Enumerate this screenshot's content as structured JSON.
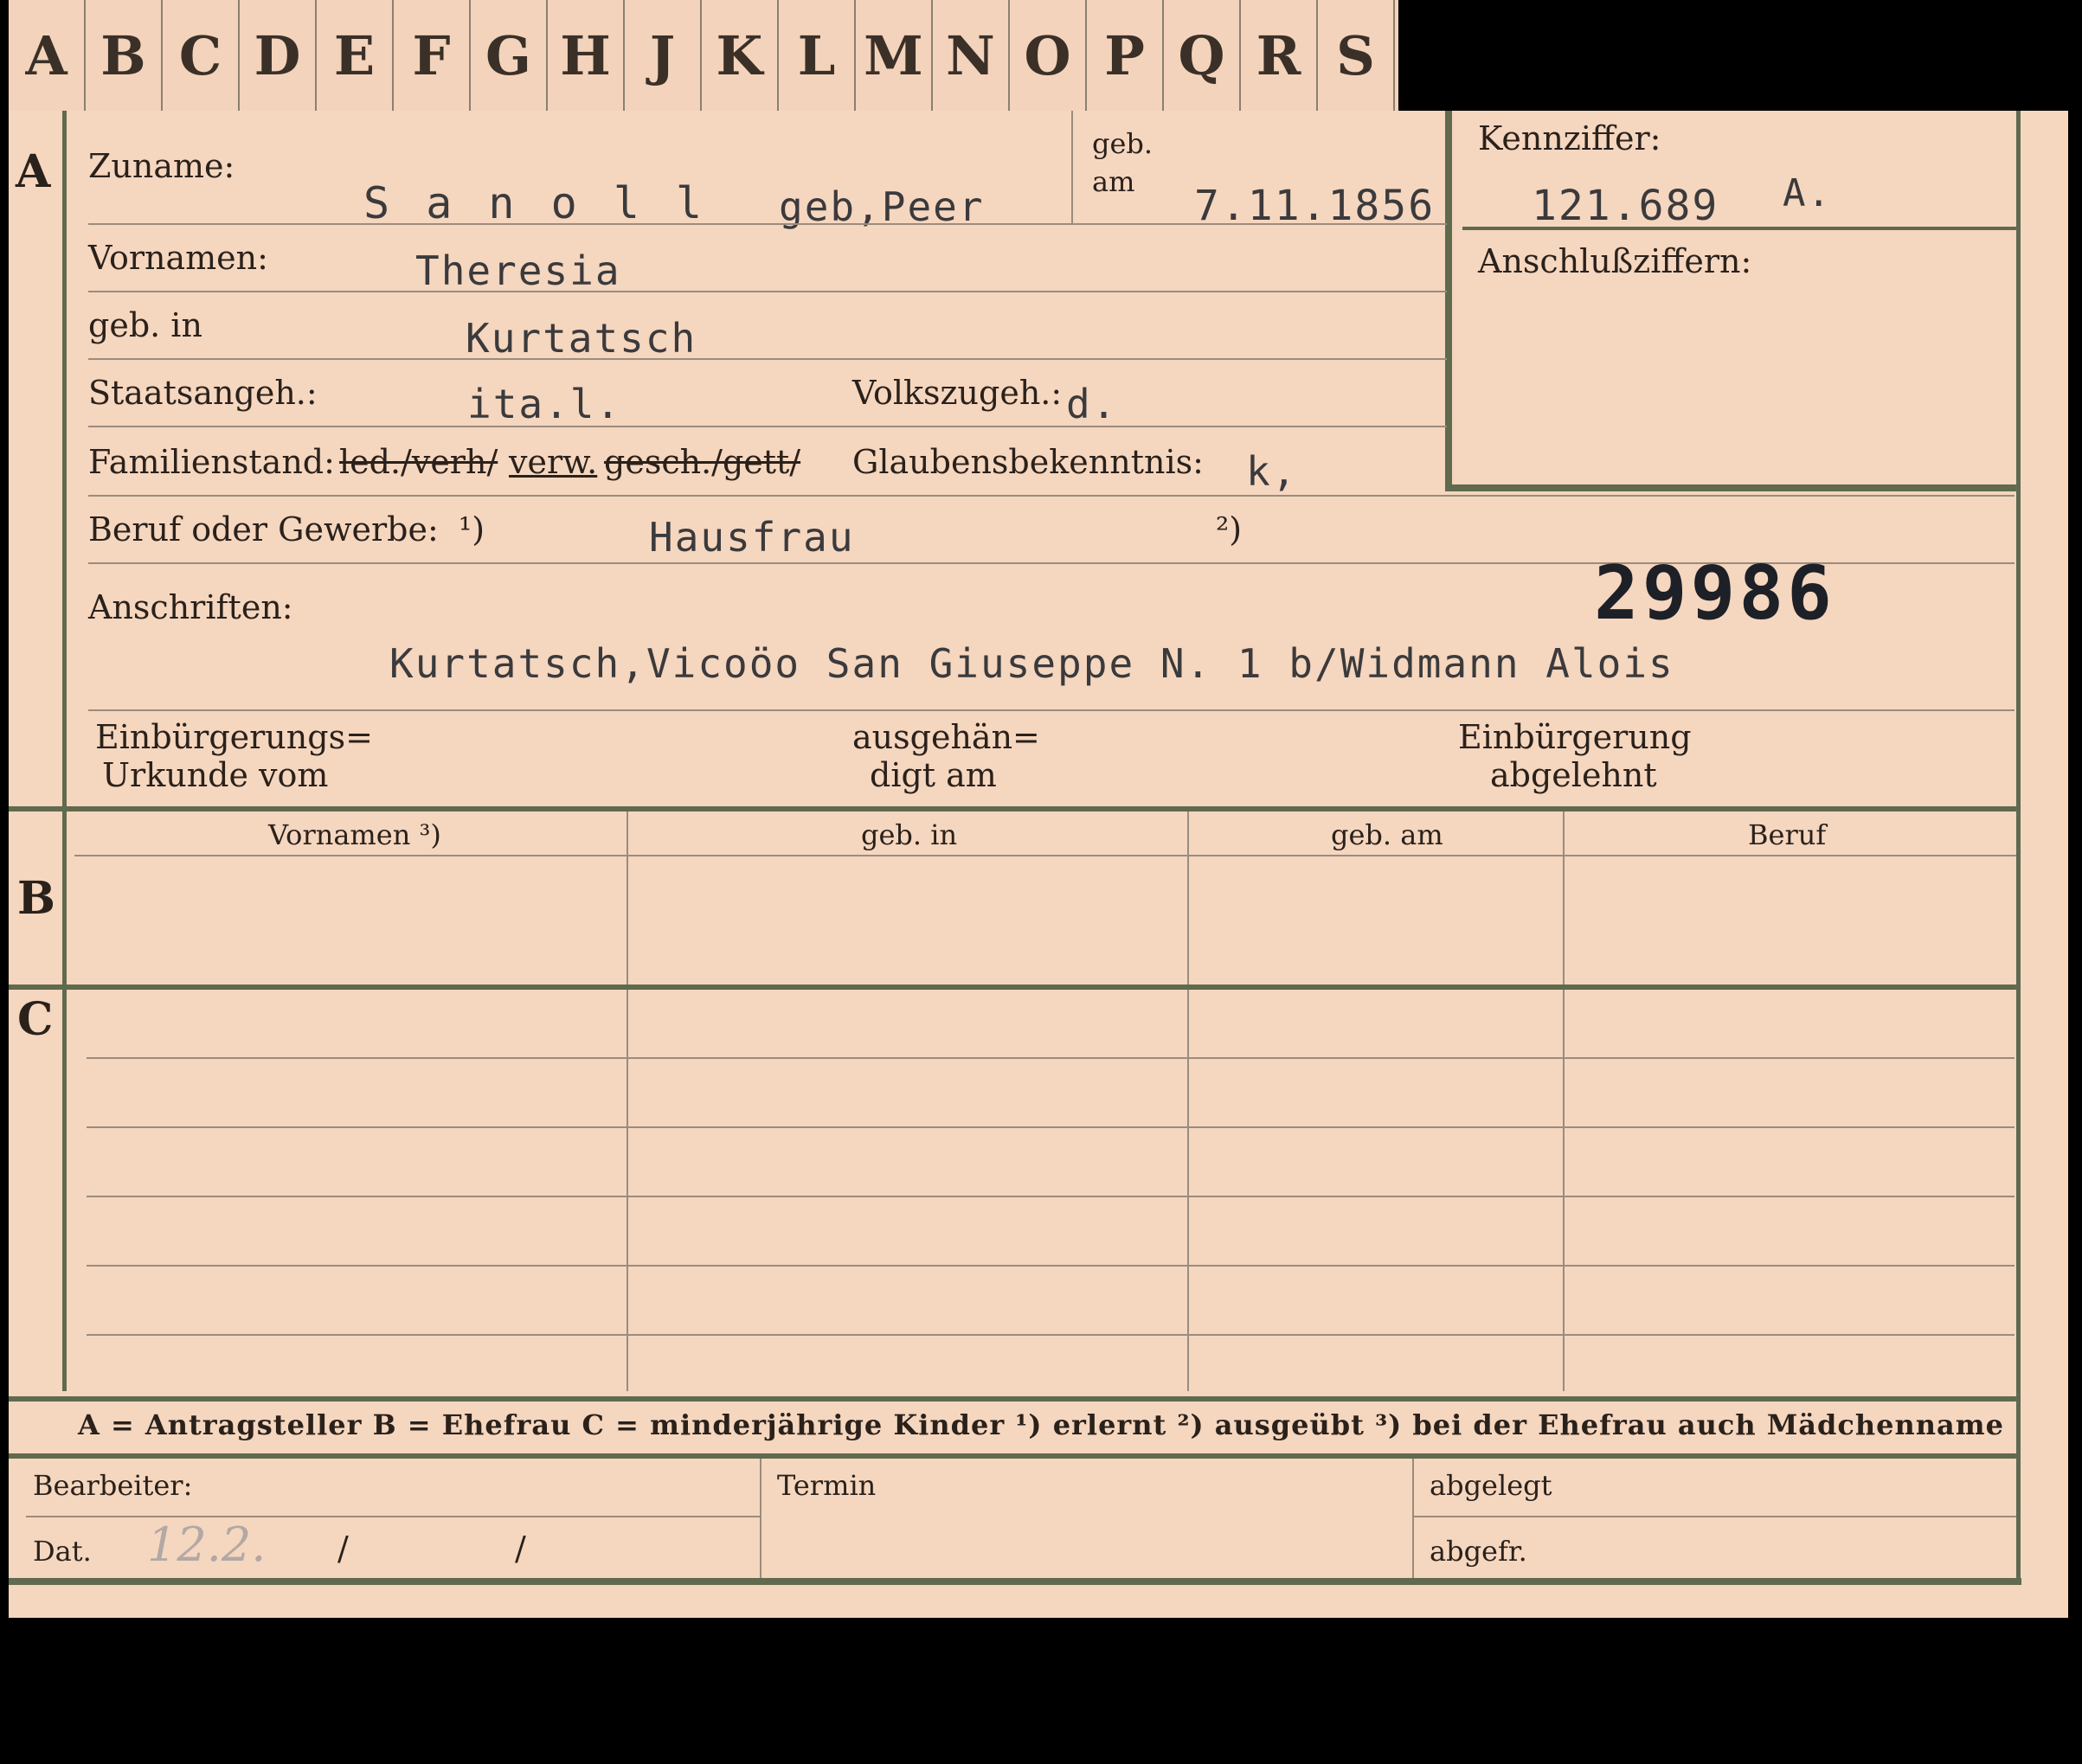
{
  "tabs": [
    "A",
    "B",
    "C",
    "D",
    "E",
    "F",
    "G",
    "H",
    "J",
    "K",
    "L",
    "M",
    "N",
    "O",
    "P",
    "Q",
    "R",
    "S"
  ],
  "sections": {
    "a": "A",
    "b": "B",
    "c": "C"
  },
  "applicant": {
    "surname_label": "Zuname:",
    "surname_value": "S a n o l l",
    "maiden_value": "geb,Peer",
    "born_on_label": "geb. am",
    "born_on_value": "7.11.1856",
    "given_label": "Vornamen:",
    "given_value": "Theresia",
    "birthplace_label": "geb. in",
    "birthplace_value": "Kurtatsch",
    "citizenship_label": "Staatsangeh.:",
    "citizenship_value": "ita.l.",
    "ethnicity_label": "Volkszugeh.:",
    "ethnicity_value": "d.",
    "marital_label": "Familienstand:",
    "marital_struck_1": "led./verh/",
    "marital_value": "verw.",
    "marital_struck_2": "gesch./gett/",
    "religion_label": "Glaubensbekenntnis:",
    "religion_value": "k,",
    "occupation_label": "Beruf oder Gewerbe:",
    "occupation_note_1": "¹)",
    "occupation_value": "Hausfrau",
    "occupation_note_2": "²)",
    "address_label": "Anschriften:",
    "address_value": "Kurtatsch,Vicoöo San Giuseppe N. 1 b/Widmann Alois",
    "file_number": "29986",
    "naturalization_cert_label_1": "Einbürgerungs=",
    "naturalization_cert_label_2": "Urkunde vom",
    "handed_label_1": "ausgehän=",
    "handed_label_2": "digt am",
    "refused_label_1": "Einbürgerung",
    "refused_label_2": "abgelehnt"
  },
  "id_box": {
    "code_label": "Kennziffer:",
    "code_value": "121.689",
    "code_suffix": "A.",
    "linked_label": "Anschlußziffern:"
  },
  "spouse_table": {
    "headers": [
      "Vornamen ³)",
      "geb. in",
      "geb. am",
      "Beruf"
    ]
  },
  "legend": "A = Antragsteller    B = Ehefrau    C = minderjährige Kinder    ¹) erlernt    ²) ausgeübt    ³) bei der Ehefrau auch Mädchenname",
  "footer": {
    "clerk_label": "Bearbeiter:",
    "date_label": "Dat.",
    "date_value": "12.2.",
    "slash": "/",
    "deadline_label": "Termin",
    "filed_label": "abgelegt",
    "retrieved_label": "abgefr."
  }
}
